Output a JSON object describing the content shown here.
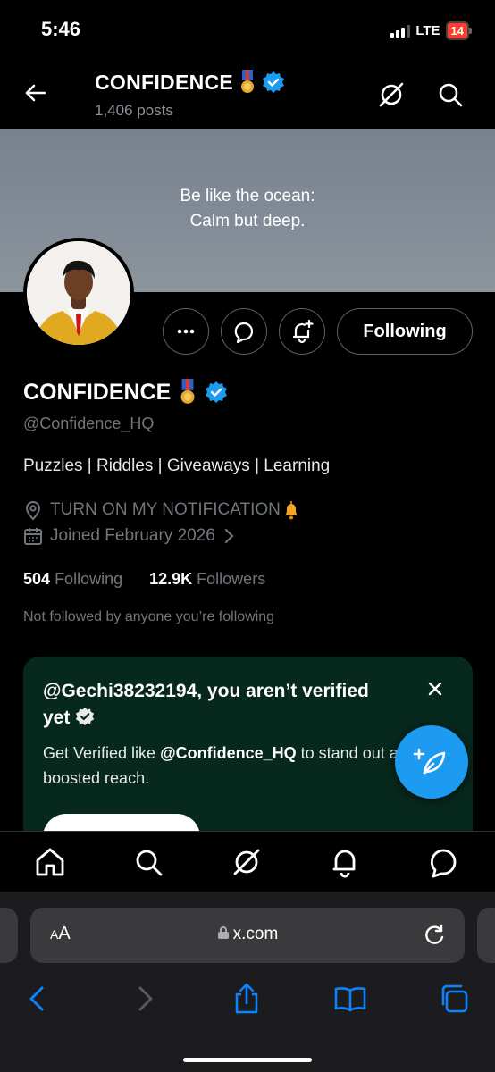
{
  "status": {
    "time": "5:46",
    "network": "LTE",
    "battery": "14"
  },
  "nav": {
    "title": "CONFIDENCE",
    "posts": "1,406 posts"
  },
  "banner": {
    "line1": "Be like the ocean:",
    "line2": "Calm but deep."
  },
  "profile": {
    "name": "CONFIDENCE",
    "handle": "@Confidence_HQ",
    "bio": "Puzzles | Riddles | Giveaways | Learning",
    "location": "TURN ON MY NOTIFICATION",
    "joined": "Joined February 2026",
    "following_count": "504",
    "following_label": "Following",
    "followers_count": "12.9K",
    "followers_label": "Followers",
    "not_followed": "Not followed by anyone you’re following"
  },
  "actions": {
    "following_button": "Following"
  },
  "verify_card": {
    "title": "@Gechi38232194, you aren’t verified yet",
    "body_prefix": "Get Verified like ",
    "body_handle": "@Confidence_HQ",
    "body_suffix": " to stand out and get boosted reach."
  },
  "browser": {
    "aa_small": "A",
    "aa_large": "A",
    "url": "x.com"
  },
  "colors": {
    "accent": "#1d9bf0",
    "card_bg": "#07281c",
    "banner": "#848d97"
  }
}
